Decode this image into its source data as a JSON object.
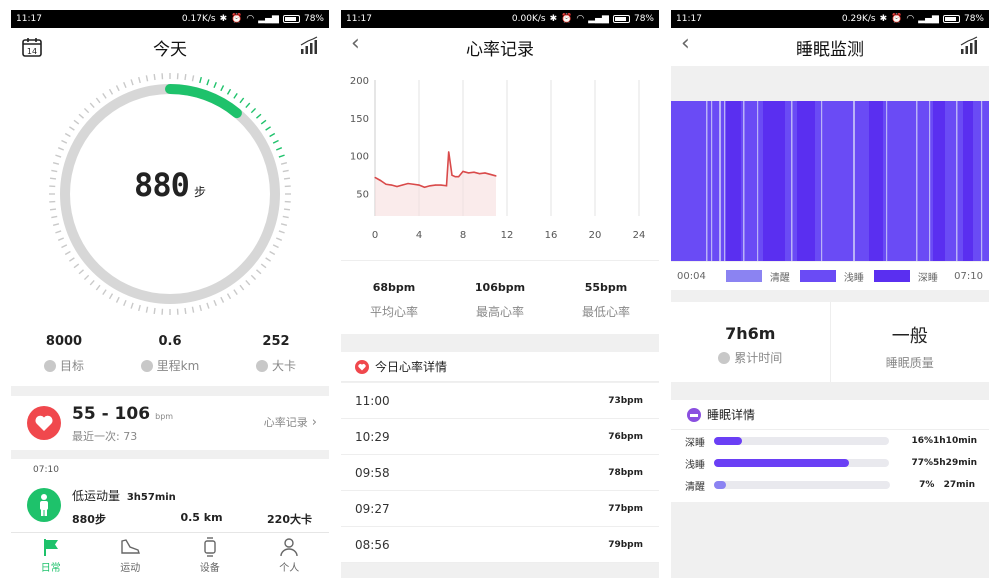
{
  "status": [
    {
      "time": "11:17",
      "speed": "0.17K/s",
      "battery": "78%"
    },
    {
      "time": "11:17",
      "speed": "0.00K/s",
      "battery": "78%"
    },
    {
      "time": "11:17",
      "speed": "0.29K/s",
      "battery": "78%"
    }
  ],
  "screen1": {
    "title": "今天",
    "calendar_day": "14",
    "steps": "880",
    "steps_unit": "步",
    "steps_progress": 0.11,
    "stats": [
      {
        "value": "8000",
        "label": "目标"
      },
      {
        "value": "0.6",
        "label": "里程km"
      },
      {
        "value": "252",
        "label": "大卡"
      }
    ],
    "heart": {
      "range": "55 - 106",
      "unit": "bpm",
      "last": "最近一次: 73",
      "link": "心率记录"
    },
    "activity": {
      "time": "07:10",
      "title": "低运动量",
      "duration": "3h57min",
      "steps": "880步",
      "distance": "0.5 km",
      "kcal": "220大卡"
    },
    "nav": [
      {
        "label": "日常",
        "icon": "flag-icon"
      },
      {
        "label": "运动",
        "icon": "shoe-icon"
      },
      {
        "label": "设备",
        "icon": "watch-icon"
      },
      {
        "label": "个人",
        "icon": "person-icon"
      }
    ],
    "colors": {
      "accent": "#1ec26b",
      "heart": "#f0484d"
    }
  },
  "screen2": {
    "title": "心率记录",
    "chart_data": {
      "type": "line",
      "x": [
        0,
        0.5,
        1,
        1.5,
        2,
        2.5,
        3,
        3.5,
        4,
        4.5,
        5,
        5.5,
        6,
        6.5,
        6.7,
        7,
        7.3,
        7.6,
        8,
        8.5,
        9,
        9.5,
        10,
        10.5,
        11
      ],
      "y": [
        71,
        67,
        62,
        61,
        59,
        61,
        63,
        62,
        61,
        58,
        60,
        61,
        61,
        60,
        105,
        74,
        72,
        72,
        79,
        77,
        78,
        76,
        77,
        75,
        73
      ],
      "xticks": [
        "0",
        "4",
        "8",
        "12",
        "16",
        "20",
        "24"
      ],
      "yticks": [
        "200",
        "150",
        "100",
        "50"
      ],
      "xlim": [
        0,
        24
      ],
      "ylim": [
        20,
        200
      ]
    },
    "stats": [
      {
        "value": "68bpm",
        "label": "平均心率"
      },
      {
        "value": "106bpm",
        "label": "最高心率"
      },
      {
        "value": "55bpm",
        "label": "最低心率"
      }
    ],
    "detail_title": "今日心率详情",
    "rows": [
      {
        "time": "11:00",
        "value": "73bpm"
      },
      {
        "time": "10:29",
        "value": "76bpm"
      },
      {
        "time": "09:58",
        "value": "78bpm"
      },
      {
        "time": "09:27",
        "value": "77bpm"
      },
      {
        "time": "08:56",
        "value": "79bpm"
      }
    ]
  },
  "screen3": {
    "title": "睡眠监测",
    "start": "00:04",
    "end": "07:10",
    "legend": [
      "清醒",
      "浅睡",
      "深睡"
    ],
    "colors": {
      "awake": "#8b83f2",
      "light": "#6a4bf5",
      "deep": "#5a2ff0"
    },
    "total": "7h6m",
    "total_label": "累计时间",
    "quality": "一般",
    "quality_label": "睡眠质量",
    "detail_title": "睡眠详情",
    "details": [
      {
        "name": "深睡",
        "pct": "16%",
        "fraction": 0.16,
        "dur": "1h10min",
        "color": "#6a3ff5"
      },
      {
        "name": "浅睡",
        "pct": "77%",
        "fraction": 0.77,
        "dur": "5h29min",
        "color": "#6a3ff5"
      },
      {
        "name": "清醒",
        "pct": "7%",
        "fraction": 0.07,
        "dur": "27min",
        "color": "#8b83f2"
      }
    ]
  }
}
